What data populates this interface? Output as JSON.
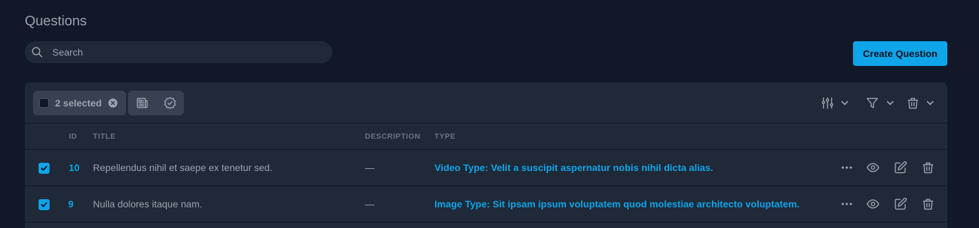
{
  "page": {
    "title": "Questions"
  },
  "search": {
    "placeholder": "Search",
    "value": ""
  },
  "actions": {
    "create_label": "Create Question"
  },
  "toolbar": {
    "selected_label": "2 selected",
    "bulk_actions": [
      "newspaper-icon",
      "badge-check-icon"
    ],
    "right_actions": [
      "adjustments-icon",
      "filter-icon",
      "trash-icon"
    ]
  },
  "table": {
    "columns": [
      "ID",
      "TITLE",
      "DESCRIPTION",
      "TYPE"
    ],
    "rows": [
      {
        "checked": true,
        "id": "10",
        "title": "Repellendus nihil et saepe ex tenetur sed.",
        "description": "—",
        "type": "Video Type: Velit a suscipit aspernatur nobis nihil dicta alias."
      },
      {
        "checked": true,
        "id": "9",
        "title": "Nulla dolores itaque nam.",
        "description": "—",
        "type": "Image Type: Sit ipsam ipsum voluptatem quod molestiae architecto voluptatem."
      }
    ],
    "row_actions": [
      "more-icon",
      "eye-icon",
      "edit-icon",
      "trash-icon"
    ]
  },
  "colors": {
    "accent": "#0ea5e9",
    "background": "#111827",
    "card": "#1f2937"
  }
}
